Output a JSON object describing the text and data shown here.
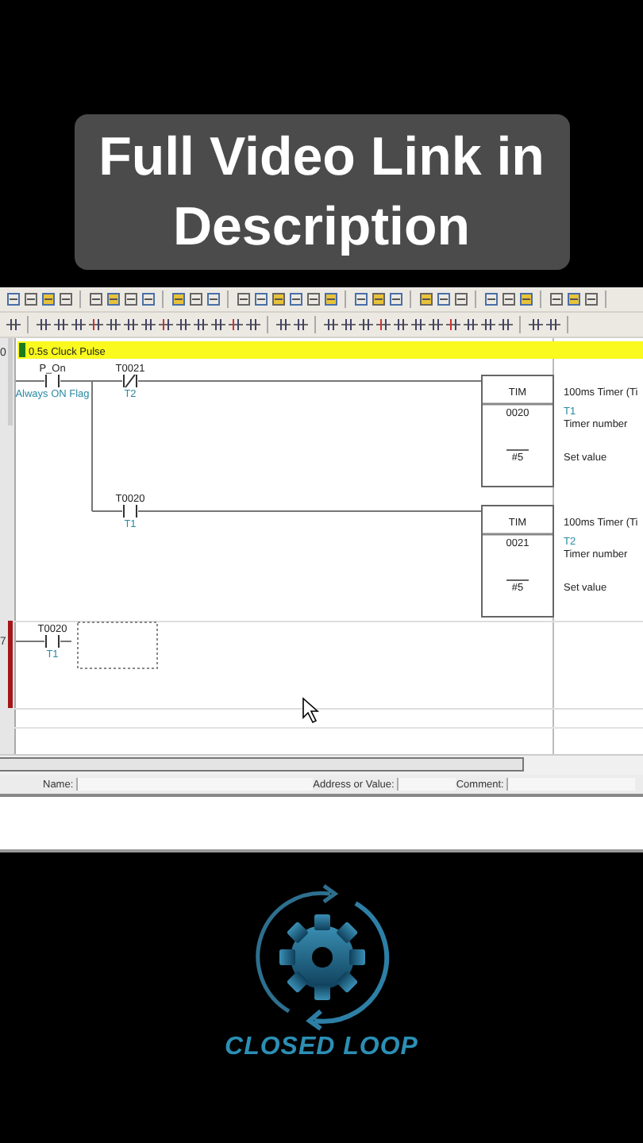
{
  "banner": {
    "lines": [
      "Full Video Link in",
      "Description"
    ]
  },
  "ladder": {
    "rungs": [
      {
        "number": "0",
        "comment": "0.5s Cluck Pulse",
        "selected": false,
        "lines": [
          {
            "contacts": [
              {
                "kind": "no",
                "address": "P_On",
                "comment": "Always ON Flag"
              },
              {
                "kind": "nc",
                "address": "T0021",
                "comment": "T2"
              }
            ],
            "timer": {
              "name": "TIM",
              "operand": "0020",
              "set_value": "#5",
              "title": "100ms Timer (Ti",
              "symbol": "T1",
              "operand_label": "Timer number",
              "set_value_label": "Set value"
            }
          },
          {
            "contacts": [
              {
                "kind": "no",
                "address": "T0020",
                "comment": "T1"
              }
            ],
            "timer": {
              "name": "TIM",
              "operand": "0021",
              "set_value": "#5",
              "title": "100ms Timer (Ti",
              "symbol": "T2",
              "operand_label": "Timer number",
              "set_value_label": "Set value"
            }
          }
        ]
      },
      {
        "number": "7",
        "selected": true,
        "lines": [
          {
            "contacts": [
              {
                "kind": "no",
                "address": "T0020",
                "comment": "T1"
              }
            ]
          }
        ]
      }
    ]
  },
  "properties": {
    "labels": [
      "Name:",
      "Address or Value:",
      "Comment:"
    ]
  },
  "logo": {
    "text": "CLOSED LOOP"
  }
}
